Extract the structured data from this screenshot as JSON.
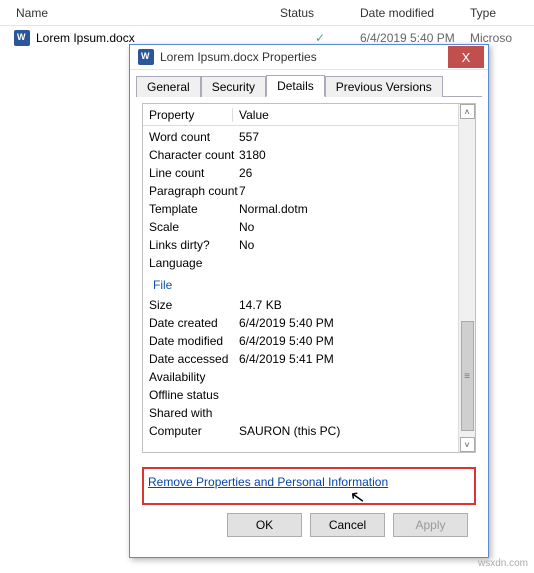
{
  "explorer": {
    "columns": {
      "name": "Name",
      "status": "Status",
      "date": "Date modified",
      "type": "Type"
    },
    "file": {
      "name": "Lorem Ipsum.docx",
      "status_glyph": "✓",
      "date": "6/4/2019 5:40 PM",
      "type": "Microso"
    }
  },
  "dialog": {
    "title": "Lorem Ipsum.docx Properties",
    "close_glyph": "X",
    "tabs": {
      "general": "General",
      "security": "Security",
      "details": "Details",
      "versions": "Previous Versions"
    },
    "headers": {
      "property": "Property",
      "value": "Value"
    },
    "section_file": "File",
    "props": {
      "word_count": {
        "k": "Word count",
        "v": "557"
      },
      "char_count": {
        "k": "Character count",
        "v": "3180"
      },
      "line_count": {
        "k": "Line count",
        "v": "26"
      },
      "para_count": {
        "k": "Paragraph count",
        "v": "7"
      },
      "template": {
        "k": "Template",
        "v": "Normal.dotm"
      },
      "scale": {
        "k": "Scale",
        "v": "No"
      },
      "links_dirty": {
        "k": "Links dirty?",
        "v": "No"
      },
      "language": {
        "k": "Language",
        "v": ""
      },
      "size": {
        "k": "Size",
        "v": "14.7 KB"
      },
      "date_created": {
        "k": "Date created",
        "v": "6/4/2019 5:40 PM"
      },
      "date_modified": {
        "k": "Date modified",
        "v": "6/4/2019 5:40 PM"
      },
      "date_accessed": {
        "k": "Date accessed",
        "v": "6/4/2019 5:41 PM"
      },
      "availability": {
        "k": "Availability",
        "v": ""
      },
      "offline_status": {
        "k": "Offline status",
        "v": ""
      },
      "shared_with": {
        "k": "Shared with",
        "v": ""
      },
      "computer": {
        "k": "Computer",
        "v": "SAURON (this PC)"
      }
    },
    "link": "Remove Properties and Personal Information",
    "buttons": {
      "ok": "OK",
      "cancel": "Cancel",
      "apply": "Apply"
    },
    "scroll": {
      "up": "˄",
      "down": "˅",
      "grip": "≡"
    }
  },
  "watermark": "wsxdn.com"
}
